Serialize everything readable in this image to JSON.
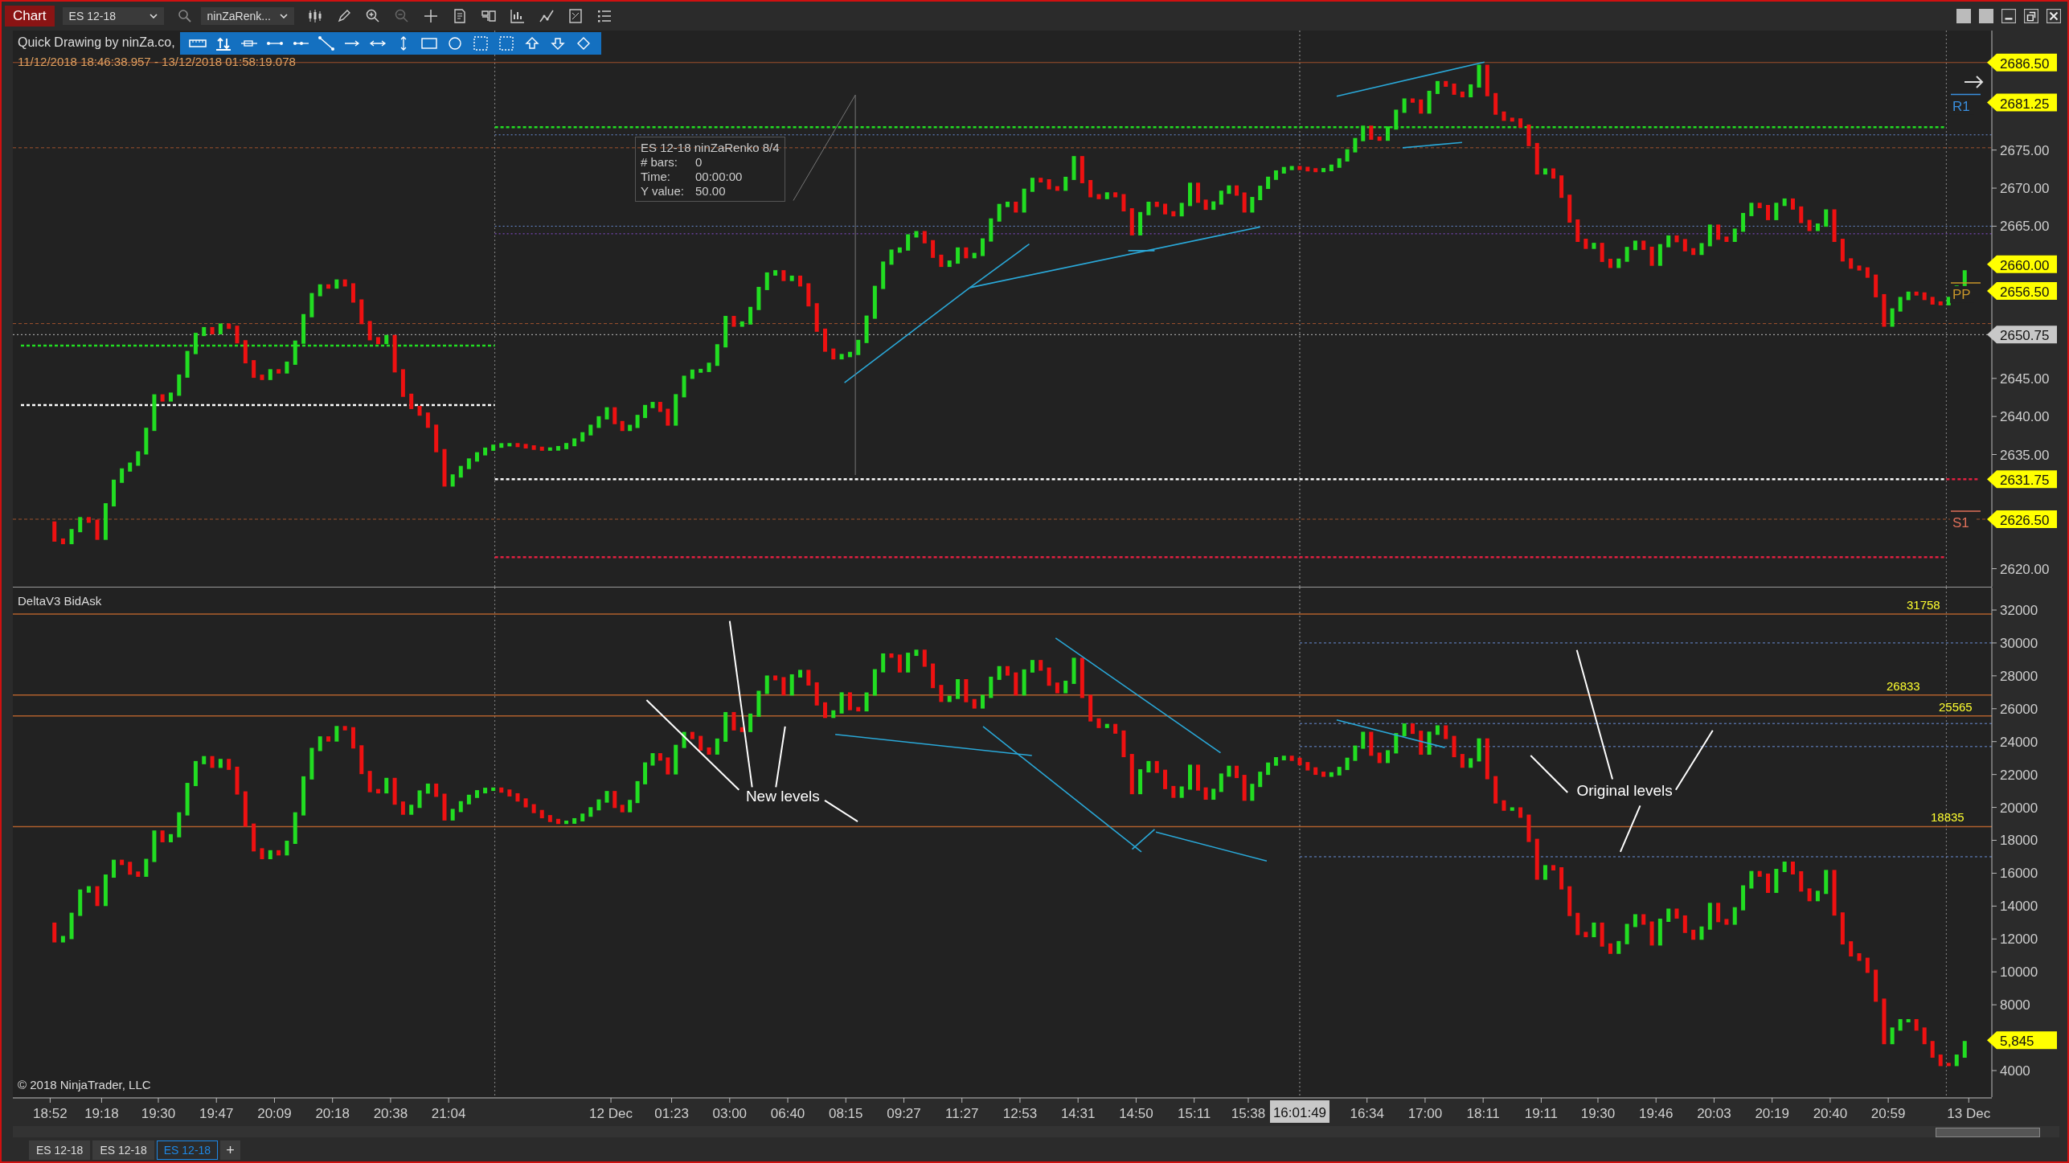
{
  "toolbar": {
    "title": "Chart",
    "instrument": "ES 12-18",
    "bar_type": "ninZaRenk..."
  },
  "drawing_toolbar": {
    "title": "Quick Drawing by ninZa.co,"
  },
  "time_range": "11/12/2018 18:46:38.957 - 13/12/2018 01:58:19.078",
  "info_box": {
    "title": "ES 12-18 ninZaRenko 8/4",
    "rows": [
      {
        "label": "# bars:",
        "value": "0"
      },
      {
        "label": "Time:",
        "value": "00:00:00"
      },
      {
        "label": "Y value:",
        "value": "50.00"
      }
    ]
  },
  "price_panel": {
    "axis_labels": [
      "2675.00",
      "2670.00",
      "2665.00",
      "2645.00",
      "2640.00",
      "2635.00",
      "2620.00"
    ],
    "tags": [
      {
        "value": "2686.50",
        "kind": "marker"
      },
      {
        "value": "2681.25",
        "kind": "marker",
        "pivot": "R1",
        "color": "#3a8fdf"
      },
      {
        "value": "2660.00",
        "kind": "marker"
      },
      {
        "value": "2656.50",
        "kind": "marker",
        "pivot": "PP",
        "color": "#c8962a"
      },
      {
        "value": "2650.75",
        "kind": "last"
      },
      {
        "value": "2631.75",
        "kind": "marker"
      },
      {
        "value": "2626.50",
        "kind": "marker",
        "pivot": "S1",
        "color": "#e0705a"
      }
    ]
  },
  "lower_panel": {
    "title": "DeltaV3 BidAsk",
    "axis_labels": [
      "32000",
      "30000",
      "28000",
      "26000",
      "24000",
      "22000",
      "20000",
      "18000",
      "16000",
      "14000",
      "12000",
      "10000",
      "8000",
      "4000"
    ],
    "levels": [
      {
        "value": "31758"
      },
      {
        "value": "26833"
      },
      {
        "value": "25565"
      },
      {
        "value": "18835"
      }
    ],
    "tag": "5,845",
    "notes": [
      {
        "text": "New levels"
      },
      {
        "text": "Original levels"
      }
    ],
    "copyright": "© 2018 NinjaTrader, LLC"
  },
  "time_axis": {
    "labels": [
      "18:52",
      "19:18",
      "19:30",
      "19:47",
      "20:09",
      "20:18",
      "20:38",
      "21:04",
      "12 Dec",
      "01:23",
      "03:00",
      "06:40",
      "08:15",
      "09:27",
      "11:27",
      "12:53",
      "14:31",
      "14:50",
      "15:11",
      "15:38",
      "16:34",
      "17:00",
      "18:11",
      "19:11",
      "19:30",
      "19:46",
      "20:03",
      "20:19",
      "20:40",
      "20:59",
      "13 Dec"
    ],
    "cursor_label": "16:01:49"
  },
  "tabs": [
    {
      "label": "ES 12-18",
      "selected": false
    },
    {
      "label": "ES 12-18",
      "selected": false
    },
    {
      "label": "ES 12-18",
      "selected": true
    }
  ],
  "add_tab": "+"
}
